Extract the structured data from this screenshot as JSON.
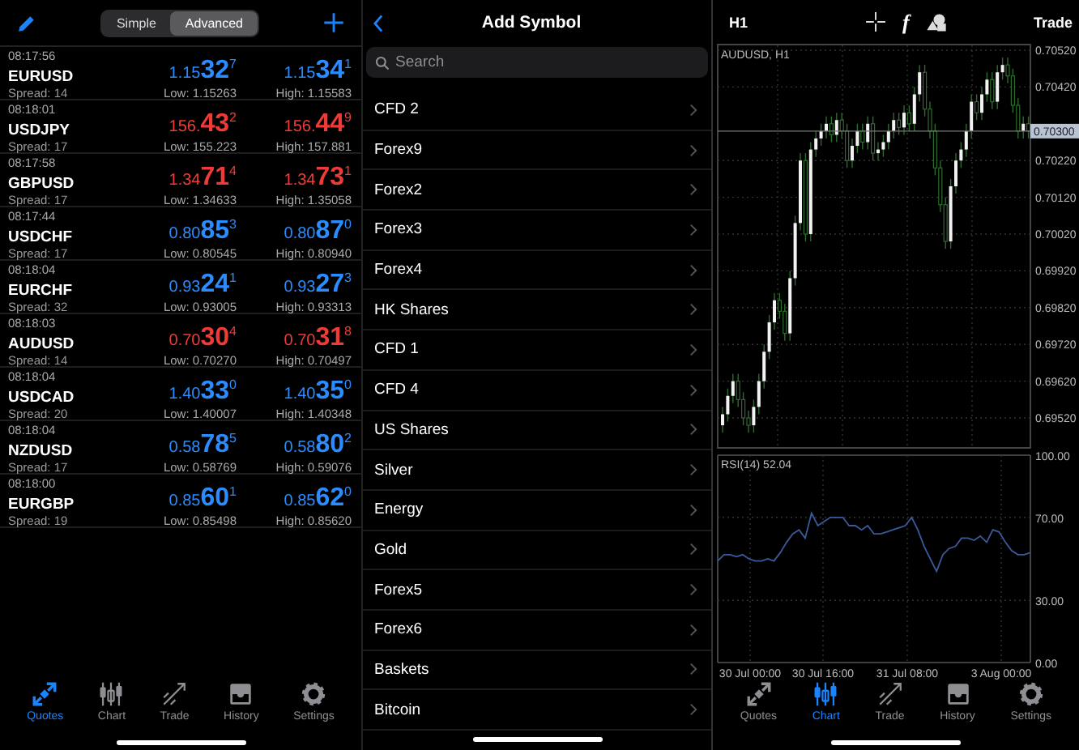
{
  "quotes_panel": {
    "modes": [
      {
        "label": "Simple",
        "selected": false
      },
      {
        "label": "Advanced",
        "selected": true
      }
    ],
    "quotes": [
      {
        "time": "08:17:56",
        "symbol": "EURUSD",
        "spread": "Spread: 14",
        "color": "#2a8cff",
        "bid": {
          "prefix": "1.15",
          "big": "32",
          "sup": "7"
        },
        "ask": {
          "prefix": "1.15",
          "big": "34",
          "sup": "1"
        },
        "low": "Low: 1.15263",
        "high": "High: 1.15583"
      },
      {
        "time": "08:18:01",
        "symbol": "USDJPY",
        "spread": "Spread: 17",
        "color": "#ef3b36",
        "bid": {
          "prefix": "156.",
          "big": "43",
          "sup": "2"
        },
        "ask": {
          "prefix": "156.",
          "big": "44",
          "sup": "9"
        },
        "low": "Low: 155.223",
        "high": "High: 157.881"
      },
      {
        "time": "08:17:58",
        "symbol": "GBPUSD",
        "spread": "Spread: 17",
        "color": "#ef3b36",
        "bid": {
          "prefix": "1.34",
          "big": "71",
          "sup": "4"
        },
        "ask": {
          "prefix": "1.34",
          "big": "73",
          "sup": "1"
        },
        "low": "Low: 1.34633",
        "high": "High: 1.35058"
      },
      {
        "time": "08:17:44",
        "symbol": "USDCHF",
        "spread": "Spread: 17",
        "color": "#2a8cff",
        "bid": {
          "prefix": "0.80",
          "big": "85",
          "sup": "3"
        },
        "ask": {
          "prefix": "0.80",
          "big": "87",
          "sup": "0"
        },
        "low": "Low: 0.80545",
        "high": "High: 0.80940"
      },
      {
        "time": "08:18:04",
        "symbol": "EURCHF",
        "spread": "Spread: 32",
        "color": "#2a8cff",
        "bid": {
          "prefix": "0.93",
          "big": "24",
          "sup": "1"
        },
        "ask": {
          "prefix": "0.93",
          "big": "27",
          "sup": "3"
        },
        "low": "Low: 0.93005",
        "high": "High: 0.93313"
      },
      {
        "time": "08:18:03",
        "symbol": "AUDUSD",
        "spread": "Spread: 14",
        "color": "#ef3b36",
        "bid": {
          "prefix": "0.70",
          "big": "30",
          "sup": "4"
        },
        "ask": {
          "prefix": "0.70",
          "big": "31",
          "sup": "8"
        },
        "low": "Low: 0.70270",
        "high": "High: 0.70497"
      },
      {
        "time": "08:18:04",
        "symbol": "USDCAD",
        "spread": "Spread: 20",
        "color": "#2a8cff",
        "bid": {
          "prefix": "1.40",
          "big": "33",
          "sup": "0"
        },
        "ask": {
          "prefix": "1.40",
          "big": "35",
          "sup": "0"
        },
        "low": "Low: 1.40007",
        "high": "High: 1.40348"
      },
      {
        "time": "08:18:04",
        "symbol": "NZDUSD",
        "spread": "Spread: 17",
        "color": "#2a8cff",
        "bid": {
          "prefix": "0.58",
          "big": "78",
          "sup": "5"
        },
        "ask": {
          "prefix": "0.58",
          "big": "80",
          "sup": "2"
        },
        "low": "Low: 0.58769",
        "high": "High: 0.59076"
      },
      {
        "time": "08:18:00",
        "symbol": "EURGBP",
        "spread": "Spread: 19",
        "color": "#2a8cff",
        "bid": {
          "prefix": "0.85",
          "big": "60",
          "sup": "1"
        },
        "ask": {
          "prefix": "0.85",
          "big": "62",
          "sup": "0"
        },
        "low": "Low: 0.85498",
        "high": "High: 0.85620"
      }
    ],
    "tab_bar": [
      {
        "label": "Quotes",
        "kind": "quotes",
        "selected": true
      },
      {
        "label": "Chart",
        "kind": "chart",
        "selected": false
      },
      {
        "label": "Trade",
        "kind": "trade",
        "selected": false
      },
      {
        "label": "History",
        "kind": "history",
        "selected": false
      },
      {
        "label": "Settings",
        "kind": "settings",
        "selected": false
      }
    ]
  },
  "symbol_panel": {
    "title": "Add Symbol",
    "search": {
      "placeholder": "Search"
    },
    "groups": [
      "CFD 2",
      "Forex9",
      "Forex2",
      "Forex3",
      "Forex4",
      "HK Shares",
      "CFD 1",
      "CFD 4",
      "US Shares",
      "Silver",
      "Energy",
      "Gold",
      "Forex5",
      "Forex6",
      "Baskets",
      "Bitcoin"
    ]
  },
  "chart_panel": {
    "timeframe": "H1",
    "indicator_button": "f",
    "trade_label": "Trade",
    "chart_title": "AUDUSD, H1",
    "price_labels": [
      "0.70520",
      "0.70420",
      "0.70220",
      "0.70120",
      "0.70020",
      "0.69920",
      "0.69820",
      "0.69720",
      "0.69620",
      "0.69520"
    ],
    "current_price": "0.70300",
    "time_labels": [
      "30 Jul 00:00",
      "30 Jul 16:00",
      "31 Jul 08:00",
      "3 Aug 00:00"
    ],
    "chart_data": {
      "type": "line",
      "title": "RSI(14) 52.04",
      "grid": true,
      "ylim": [
        0,
        100
      ],
      "yticks": [
        {
          "value": 0,
          "label": "0.00"
        },
        {
          "value": 30,
          "label": "30.00"
        },
        {
          "value": 70,
          "label": "70.00"
        },
        {
          "value": 100,
          "label": "100.00"
        }
      ],
      "series": [
        {
          "color": "#3a5a9a",
          "values": [
            49,
            52,
            52,
            51,
            52,
            50,
            49,
            49,
            50,
            49,
            53,
            58,
            62,
            64,
            60,
            72,
            66,
            68,
            70,
            70,
            70,
            66,
            66,
            64,
            66,
            62,
            62,
            63,
            64,
            65,
            66,
            70,
            64,
            56,
            50,
            44,
            52,
            55,
            56,
            60,
            60,
            59,
            61,
            58,
            64,
            63,
            58,
            54,
            52,
            52,
            53
          ]
        }
      ]
    },
    "tab_bar": [
      {
        "label": "Quotes",
        "kind": "quotes",
        "selected": false
      },
      {
        "label": "Chart",
        "kind": "chart",
        "selected": true
      },
      {
        "label": "Trade",
        "kind": "trade",
        "selected": false
      },
      {
        "label": "History",
        "kind": "history",
        "selected": false
      },
      {
        "label": "Settings",
        "kind": "settings",
        "selected": false
      }
    ]
  }
}
